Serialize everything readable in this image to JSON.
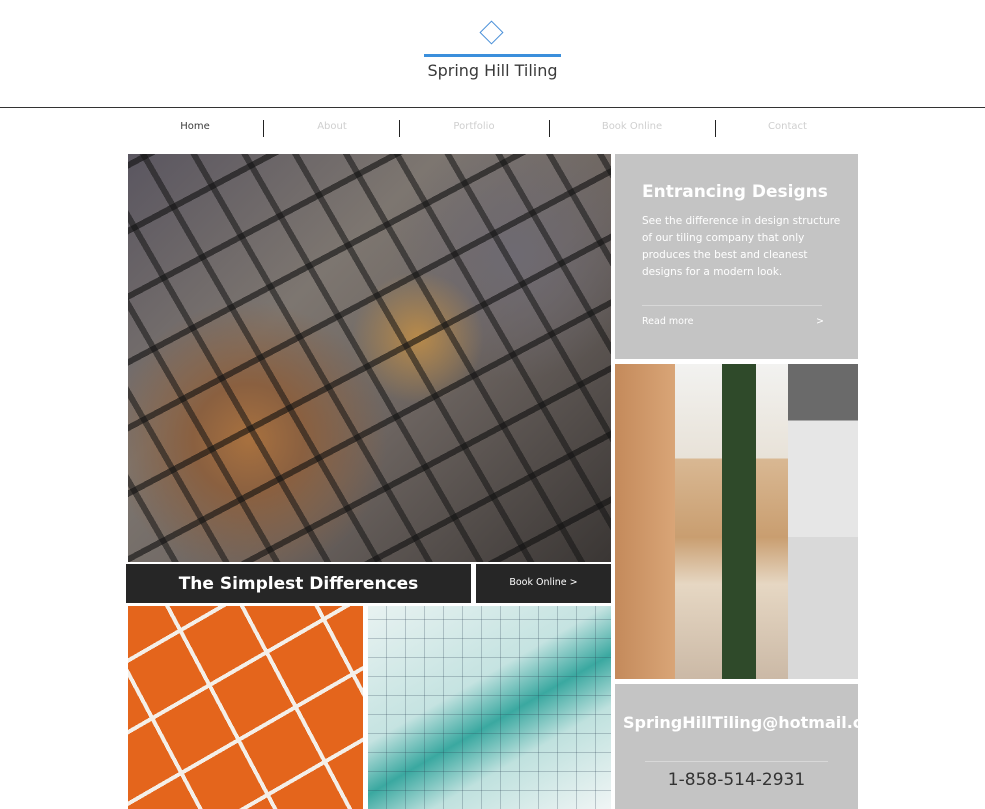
{
  "site": {
    "title": "Spring Hill Tiling"
  },
  "nav": [
    {
      "label": "Home",
      "active": true
    },
    {
      "label": "About",
      "active": false
    },
    {
      "label": "Portfolio",
      "active": false
    },
    {
      "label": "Book Online",
      "active": false
    },
    {
      "label": "Contact",
      "active": false
    }
  ],
  "feature": {
    "heading": "Entrancing Designs",
    "body": "See the difference in design structure of our tiling company that only produces the best and cleanest designs for a modern look.",
    "read_more": "Read more",
    "read_more_arrow": ">"
  },
  "banner": {
    "tagline": "The Simplest Differences",
    "book_button": "Book Online >"
  },
  "contact": {
    "email": "SpringHillTiling@hotmail.com",
    "phone": "1-858-514-2931"
  },
  "colors": {
    "accent": "#3b8fdc",
    "panel_gray": "#c4c4c4",
    "dark_bar": "#262626"
  }
}
